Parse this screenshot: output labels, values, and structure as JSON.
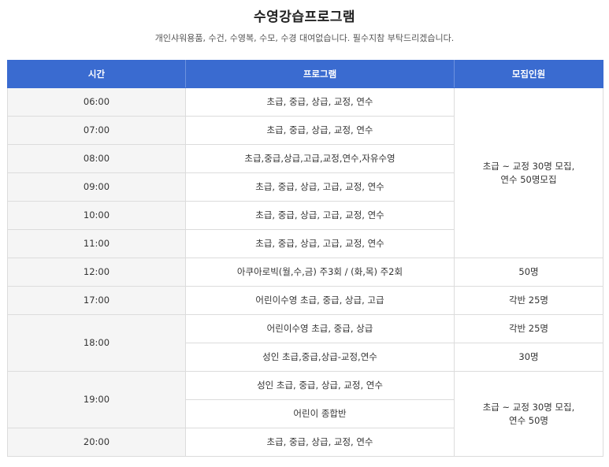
{
  "page": {
    "title": "수영강습프로그램",
    "subtitle": "개인샤워용품, 수건, 수영복, 수모, 수경 대여없습니다. 필수지참 부탁드리겠습니다."
  },
  "table": {
    "headers": {
      "time": "시간",
      "program": "프로그램",
      "recruit": "모집인원"
    },
    "rows": [
      {
        "time": "06:00",
        "program": "초급, 중급, 상급, 교정, 연수"
      },
      {
        "time": "07:00",
        "program": "초급, 중급, 상급, 교정, 연수"
      },
      {
        "time": "08:00",
        "program": "초급,중급,상급,고급,교정,연수,자유수영"
      },
      {
        "time": "09:00",
        "program": "초급, 중급, 상급, 고급, 교정, 연수"
      },
      {
        "time": "10:00",
        "program": "초급, 중급, 상급, 고급, 교정, 연수"
      },
      {
        "time": "11:00",
        "program": "초급, 중급, 상급, 고급, 교정, 연수"
      },
      {
        "time": "12:00",
        "program": "아쿠아로빅(월,수,금) 주3회 / (화,목) 주2회",
        "recruit": "50명"
      },
      {
        "time": "17:00",
        "program": "어린이수영 초급, 중급, 상급, 고급",
        "recruit": "각반 25명"
      },
      {
        "time": "18:00",
        "program": "어린이수영 초급, 중급, 상급",
        "recruit": "각반 25명"
      },
      {
        "program": "성인 초급,중급,상급-교정,연수",
        "recruit": "30명"
      },
      {
        "time": "19:00",
        "program": "성인 초급, 중급, 상급, 교정, 연수"
      },
      {
        "program": "어린이 종합반"
      },
      {
        "time": "20:00",
        "program": "초급, 중급, 상급, 교정, 연수"
      }
    ],
    "morning_recruit_line1": "초급 ~ 교정 30명 모집,",
    "morning_recruit_line2": "연수 50명모집",
    "evening_recruit_line1": "초급 ~ 교정 30명 모집,",
    "evening_recruit_line2": "연수 50명"
  }
}
